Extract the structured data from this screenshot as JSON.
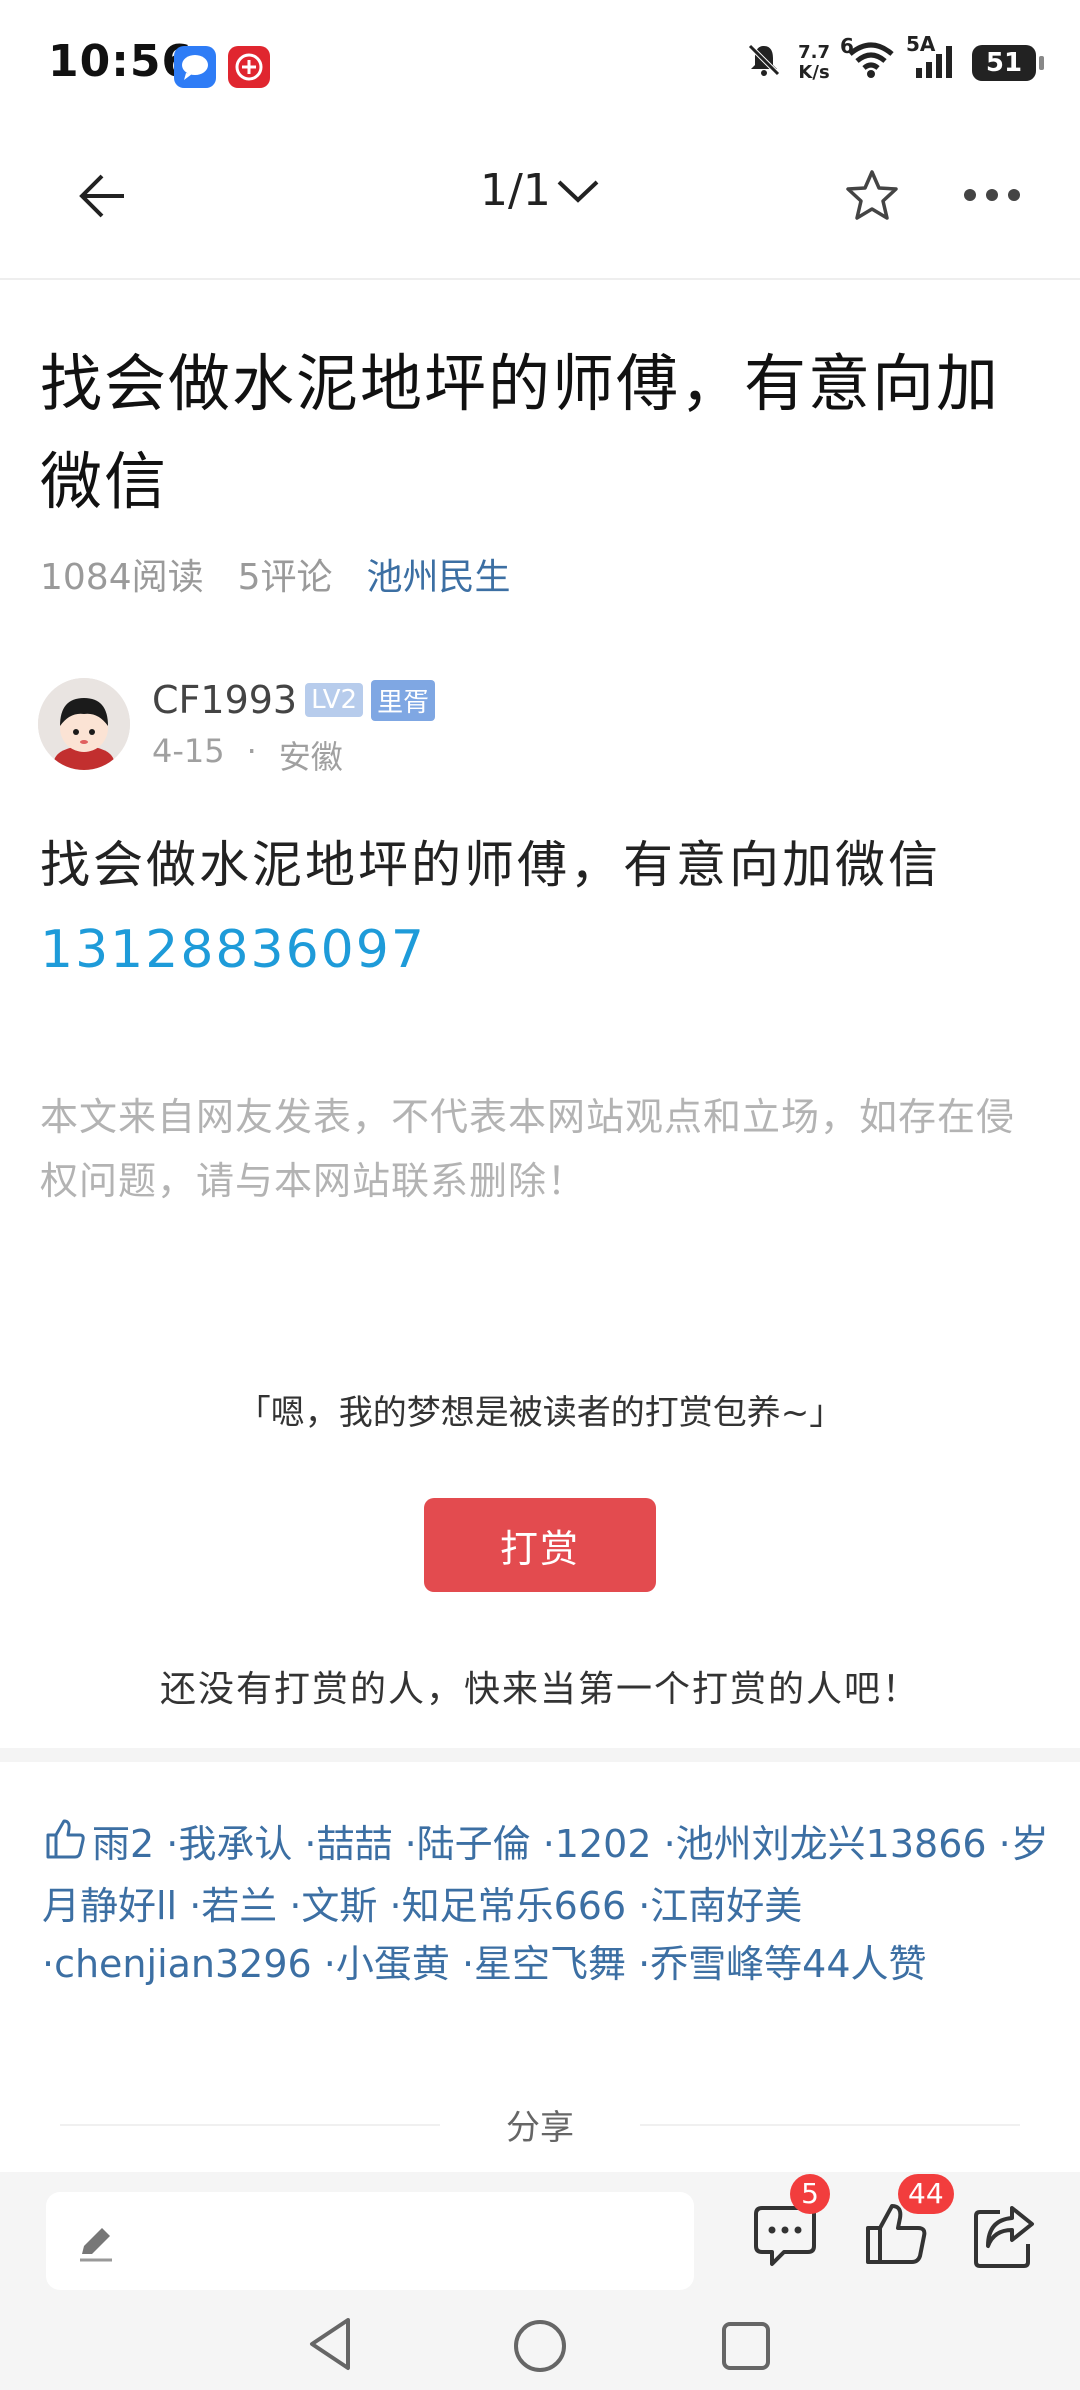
{
  "status_bar": {
    "time": "10:56",
    "speed_top": "7.7",
    "speed_bottom": "K/s",
    "wifi_label": "6",
    "signal_label": "5A",
    "battery": "51",
    "icons": [
      "message-app-icon",
      "gift-app-icon",
      "mute-icon",
      "wifi-icon",
      "signal-icon",
      "battery-icon"
    ]
  },
  "nav": {
    "pager": "1/1",
    "icons": [
      "back-arrow-icon",
      "chevron-down-icon",
      "star-icon",
      "more-icon"
    ]
  },
  "article": {
    "title": "找会做水泥地坪的师傅，有意向加微信",
    "reads": "1084阅读",
    "comments": "5评论",
    "category": "池州民生",
    "author": {
      "name": "CF1993",
      "level": "LV2",
      "tag": "里胥",
      "date": "4-15",
      "separator": "·",
      "location": "安徽"
    },
    "body": "找会做水泥地坪的师傅，有意向加微信",
    "phone": "13128836097",
    "disclaimer": "本文来自网友发表，不代表本网站观点和立场，如存在侵权问题，请与本网站联系删除！"
  },
  "reward": {
    "quote": "「嗯，我的梦想是被读者的打赏包养~」",
    "button": "打赏",
    "none_text": "还没有打赏的人，快来当第一个打赏的人吧！"
  },
  "likes": {
    "text": "雨2 ·我承认 ·喆喆 ·陆子倫 ·1202 ·池州刘龙兴13866 ·岁月静好ll ·若兰 ·文斯 ·知足常乐666 ·江南好美 ·chenjian3296 ·小蛋黄 ·星空飞舞 ·乔雪峰等44人赞"
  },
  "share": {
    "label": "分享"
  },
  "bottom_bar": {
    "comment_count": "5",
    "like_count": "44"
  },
  "colors": {
    "accent_blue": "#3c6fa3",
    "phone_blue": "#1e9bd9",
    "reward_red": "#e34b4f",
    "badge_red": "#f23d3d"
  }
}
